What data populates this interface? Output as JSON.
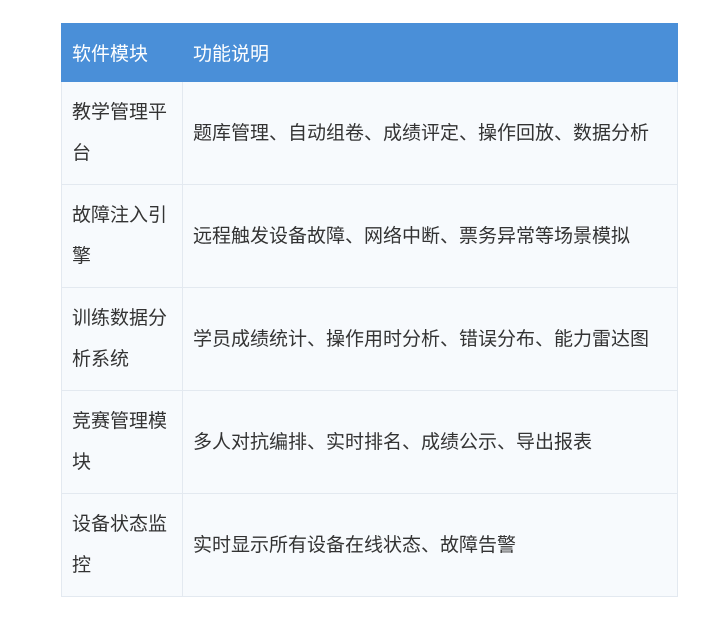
{
  "table": {
    "header": {
      "col1": "软件模块",
      "col2": "功能说明"
    },
    "rows": [
      {
        "module": "教学管理平台",
        "description": "题库管理、自动组卷、成绩评定、操作回放、数据分析"
      },
      {
        "module": "故障注入引擎",
        "description": "远程触发设备故障、网络中断、票务异常等场景模拟"
      },
      {
        "module": "训练数据分析系统",
        "description": "学员成绩统计、操作用时分析、错误分布、能力雷达图"
      },
      {
        "module": "竞赛管理模块",
        "description": "多人对抗编排、实时排名、成绩公示、导出报表"
      },
      {
        "module": "设备状态监控",
        "description": "实时显示所有设备在线状态、故障告警"
      }
    ]
  },
  "colors": {
    "header_bg": "#4a8fd8",
    "header_text": "#ffffff",
    "row_bg": "#f7fafd",
    "border": "#e3e9f0",
    "body_text": "#333333"
  }
}
